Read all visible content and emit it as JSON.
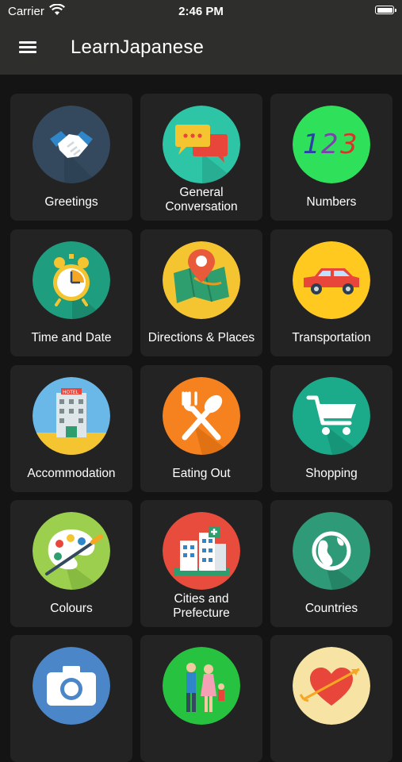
{
  "status_bar": {
    "carrier": "Carrier",
    "time": "2:46 PM"
  },
  "app_bar": {
    "title": "LearnJapanese",
    "menu_icon": "hamburger-menu-icon"
  },
  "categories": [
    {
      "label": "Greetings",
      "icon": "handshake-icon",
      "color": "#34495e"
    },
    {
      "label": "General\nConversation",
      "icon": "chat-bubbles-icon",
      "color": "#2ec4a6"
    },
    {
      "label": "Numbers",
      "icon": "numbers-123-icon",
      "color": "#2fe05a"
    },
    {
      "label": "Time and Date",
      "icon": "alarm-clock-icon",
      "color": "#1f9e7f"
    },
    {
      "label": "Directions & Places",
      "icon": "map-pin-icon",
      "color": "#f5c531"
    },
    {
      "label": "Transportation",
      "icon": "car-icon",
      "color": "#ffc91f"
    },
    {
      "label": "Accommodation",
      "icon": "hotel-icon",
      "color": "#6ab8e8"
    },
    {
      "label": "Eating Out",
      "icon": "fork-spoon-icon",
      "color": "#f5821f"
    },
    {
      "label": "Shopping",
      "icon": "shopping-cart-icon",
      "color": "#1cab8a"
    },
    {
      "label": "Colours",
      "icon": "paint-palette-icon",
      "color": "#9ccf4d"
    },
    {
      "label": "Cities and\nPrefecture",
      "icon": "city-buildings-icon",
      "color": "#e84c3c"
    },
    {
      "label": "Countries",
      "icon": "globe-icon",
      "color": "#2e9a77"
    },
    {
      "label": "",
      "icon": "camera-icon",
      "color": "#4a86c8"
    },
    {
      "label": "",
      "icon": "family-icon",
      "color": "#27c340"
    },
    {
      "label": "",
      "icon": "heart-arrow-icon",
      "color": "#f7e3a3"
    }
  ]
}
